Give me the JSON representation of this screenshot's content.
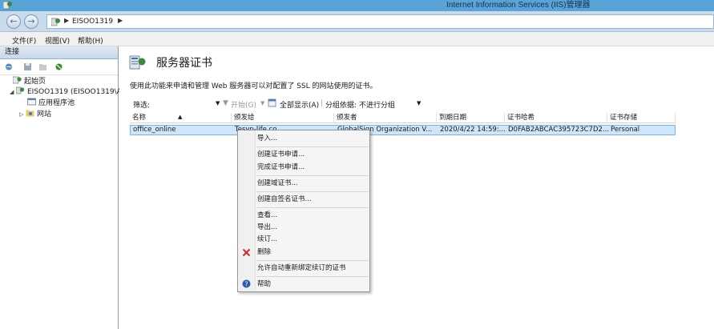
{
  "window": {
    "title": "Internet Information Services (IIS)管理器"
  },
  "address": {
    "crumb": "EISOO1319"
  },
  "menu": {
    "file": "文件(F)",
    "view": "视图(V)",
    "help": "帮助(H)"
  },
  "connections": {
    "header": "连接",
    "tree": [
      {
        "label": "起始页"
      },
      {
        "label": "EISOO1319 (EISOO1319\\Ad"
      },
      {
        "label": "应用程序池"
      },
      {
        "label": "网站"
      }
    ]
  },
  "page": {
    "title": "服务器证书",
    "description": "使用此功能来申请和管理 Web 服务器可以对配置了 SSL 的网站使用的证书。",
    "filter": {
      "label": "筛选:",
      "go": "开始(G)",
      "show_all": "全部显示(A)",
      "group_by_label": "分组依据:",
      "group_by_value": "不进行分组"
    }
  },
  "table": {
    "headers": [
      "名称",
      "颁发给",
      "颁发者",
      "到期日期",
      "证书哈希",
      "证书存储"
    ],
    "rows": [
      [
        "office_online",
        "Tesyp-life.co",
        "GlobalSign Organization V...",
        "2020/4/22 14:59:...",
        "D0FAB2ABCAC395723C7D2...",
        "Personal"
      ]
    ]
  },
  "context_menu": {
    "import": "导入...",
    "create_request": "创建证书申请...",
    "complete_request": "完成证书申请...",
    "create_domain": "创建域证书...",
    "create_self_signed": "创建自签名证书...",
    "view": "查看...",
    "export": "导出...",
    "renew": "续订...",
    "remove": "删除",
    "auto_rebind": "允许自动重新绑定续订的证书",
    "help": "帮助"
  },
  "colors": {
    "titlebar": "#5aa3d6",
    "selection": "#cfe6fa",
    "delete_icon": "#d12b2b",
    "help_icon": "#2a5db0"
  }
}
